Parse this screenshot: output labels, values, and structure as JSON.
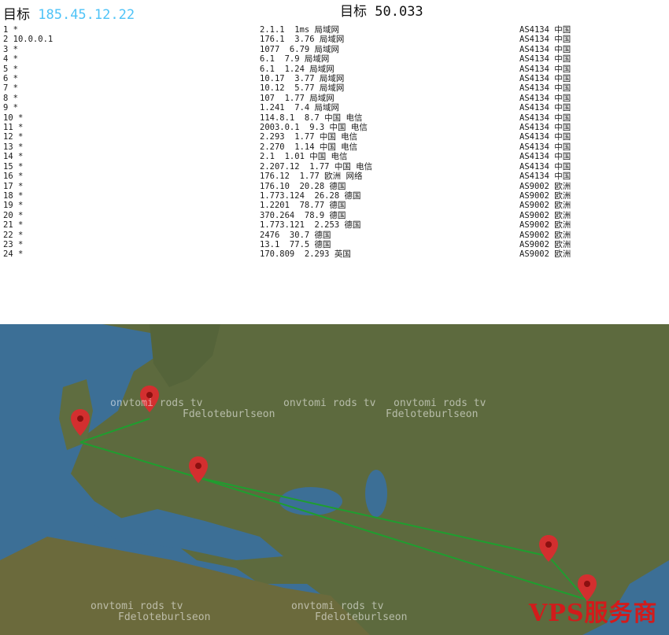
{
  "header": {
    "left_label": "目标",
    "ip": "185.45.12.22",
    "right_label": "目标",
    "right_value": "50.033"
  },
  "trace": {
    "col1": [
      "1 *",
      "2 10.0.0.1",
      "3 *",
      "4 *",
      "5 *",
      "6 *",
      "7 *",
      "8 *",
      "9 *",
      "10 *",
      "11 *",
      "12 *",
      "13 *",
      "14 *",
      "15 *",
      "16 *",
      "17 *",
      "18 *",
      "19 *",
      "20 *",
      "21 *",
      "22 *",
      "23 *",
      "24 *"
    ],
    "col2": [
      "2.1.1  1ms 局域网",
      "176.1  3.76 局域网",
      "1077  6.79 局域网",
      "6.1  7.9 局域网",
      "6.1  1.24 局域网",
      "10.17  3.77 局域网",
      "10.12  5.77 局域网",
      "107  1.77 局域网",
      "1.241  7.4 局域网",
      "114.8.1  8.7 中国 电信",
      "2003.0.1  9.3 中国 电信",
      "2.293  1.77 中国 电信",
      "2.270  1.14 中国 电信",
      "2.1  1.01 中国 电信",
      "2.207.12  1.77 中国 电信",
      "176.12  1.77 欧洲 网络",
      "176.10  20.28 德国",
      "1.773.124  26.28 德国",
      "1.2201  78.77 德国",
      "370.264  78.9 德国",
      "1.773.121  2.253 德国",
      "2476  30.7 德国",
      "13.1  77.5 德国",
      "170.809  2.293 英国"
    ],
    "col3": [
      "AS4134 中国",
      "AS4134 中国",
      "AS4134 中国",
      "AS4134 中国",
      "AS4134 中国",
      "AS4134 中国",
      "AS4134 中国",
      "AS4134 中国",
      "AS4134 中国",
      "AS4134 中国",
      "AS4134 中国",
      "AS4134 中国",
      "AS4134 中国",
      "AS4134 中国",
      "AS4134 中国",
      "AS4134 中国",
      "AS9002 欧洲",
      "AS9002 欧洲",
      "AS9002 欧洲",
      "AS9002 欧洲",
      "AS9002 欧洲",
      "AS9002 欧洲",
      "AS9002 欧洲",
      "AS9002 欧洲"
    ]
  },
  "map": {
    "watermark_a": "onvtomi rods tv",
    "watermark_b": "Fdeloteburlseon",
    "route_color": "#1f9e2f",
    "pin_color": "#d32f2f",
    "land_color": "#5d6a3e",
    "sea_color": "#3c6f96",
    "brand": "VPS服务商"
  }
}
